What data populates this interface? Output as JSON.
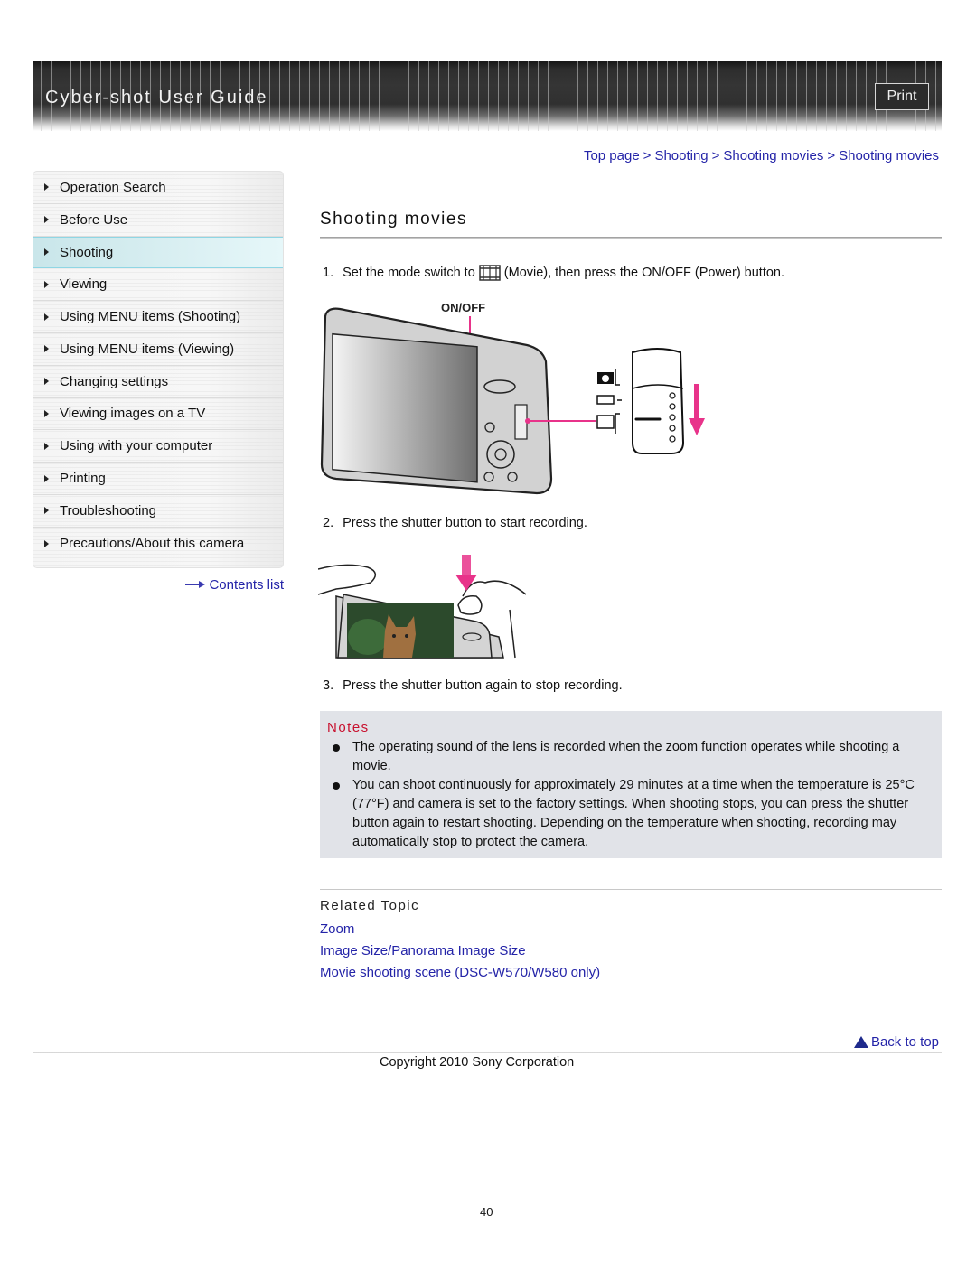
{
  "header": {
    "title": "Cyber-shot User Guide",
    "print_label": "Print"
  },
  "sidebar": {
    "items": [
      {
        "label": "Operation Search",
        "active": false
      },
      {
        "label": "Before Use",
        "active": false
      },
      {
        "label": "Shooting",
        "active": true
      },
      {
        "label": "Viewing",
        "active": false
      },
      {
        "label": "Using MENU items (Shooting)",
        "active": false
      },
      {
        "label": "Using MENU items (Viewing)",
        "active": false
      },
      {
        "label": "Changing settings",
        "active": false
      },
      {
        "label": "Viewing images on a TV",
        "active": false
      },
      {
        "label": "Using with your computer",
        "active": false
      },
      {
        "label": "Printing",
        "active": false
      },
      {
        "label": "Troubleshooting",
        "active": false
      },
      {
        "label": "Precautions/About this camera",
        "active": false
      }
    ],
    "contents_link": "Contents list"
  },
  "breadcrumb": {
    "items": [
      "Top page",
      "Shooting",
      "Shooting movies",
      "Shooting movies"
    ],
    "separator": ">"
  },
  "main": {
    "title": "Shooting movies",
    "steps": [
      {
        "num": "1.",
        "text_before": "Set the mode switch to",
        "icon": "movie-mode-icon",
        "text_after": "(Movie), then press the ON/OFF (Power) button."
      },
      {
        "num": "2.",
        "text": "Press the shutter button to start recording."
      },
      {
        "num": "3.",
        "text": "Press the shutter button again to stop recording."
      }
    ],
    "figure1": {
      "label": "ON/OFF"
    },
    "notes": {
      "title": "Notes",
      "items": [
        "The operating sound of the lens is recorded when the zoom function operates while shooting a movie.",
        "You can shoot continuously for approximately 29 minutes at a time when the temperature is 25°C (77°F) and camera is set to the factory settings. When shooting stops, you can press the shutter button again to restart shooting. Depending on the temperature when shooting, recording may automatically stop to protect the camera."
      ]
    },
    "related": {
      "title": "Related Topic",
      "links": [
        "Zoom",
        "Image Size/Panorama Image Size",
        "Movie shooting scene (DSC-W570/W580 only)"
      ]
    }
  },
  "footer": {
    "back_to_top": "Back to top",
    "copyright": "Copyright 2010 Sony Corporation",
    "page_number": "40"
  },
  "colors": {
    "link": "#2424a8",
    "notes_title": "#c8102e",
    "accent_pink": "#e8338a",
    "active_nav": "#d4ecef"
  }
}
